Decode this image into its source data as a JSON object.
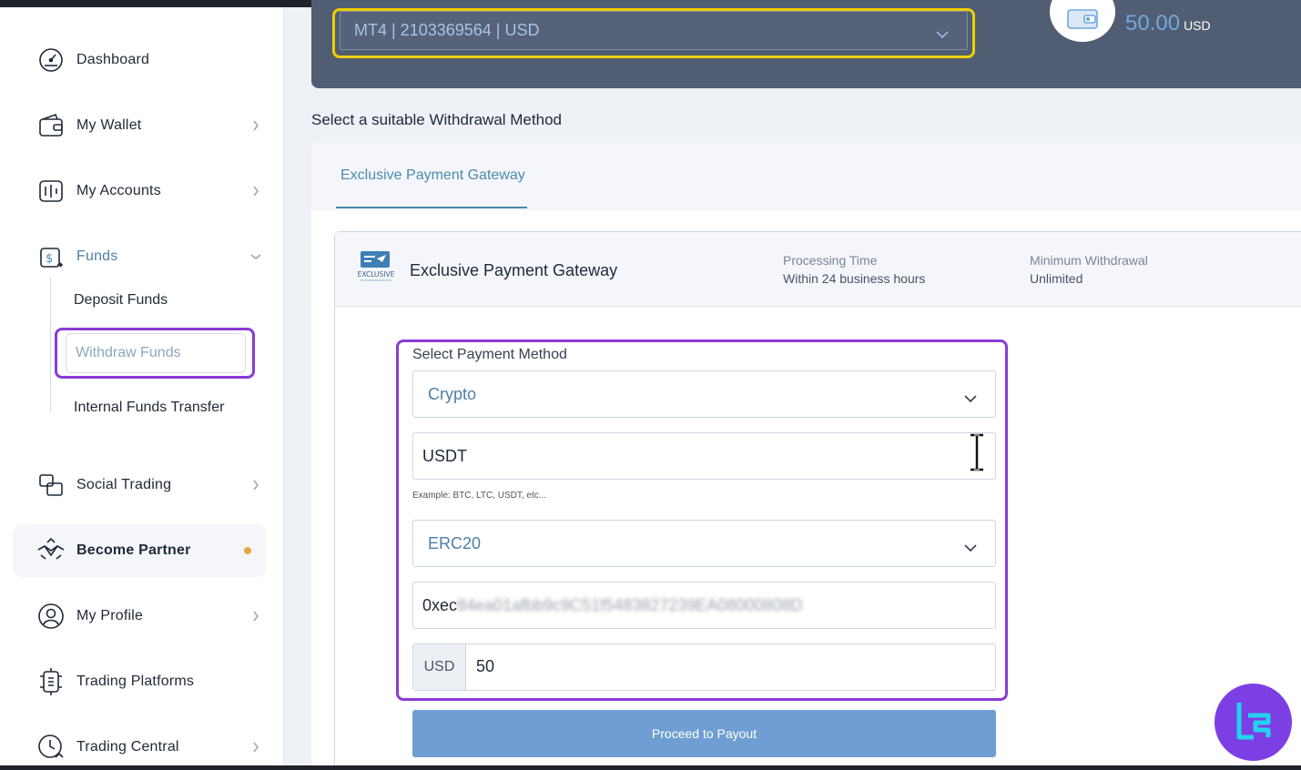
{
  "sidebar": {
    "items": [
      {
        "label": "Dashboard",
        "icon": "dashboard-gauge-icon"
      },
      {
        "label": "My Wallet",
        "icon": "wallet-icon"
      },
      {
        "label": "My Accounts",
        "icon": "accounts-icon"
      },
      {
        "label": "Funds",
        "icon": "funds-transfer-icon"
      },
      {
        "label": "Social Trading",
        "icon": "social-trading-icon"
      },
      {
        "label": "Become Partner",
        "icon": "handshake-icon"
      },
      {
        "label": "My Profile",
        "icon": "user-profile-icon"
      },
      {
        "label": "Trading Platforms",
        "icon": "platform-chip-icon"
      },
      {
        "label": "Trading Central",
        "icon": "clock-chart-icon"
      }
    ],
    "funds_sub": {
      "deposit": "Deposit Funds",
      "withdraw": "Withdraw Funds",
      "internal": "Internal Funds Transfer"
    }
  },
  "header": {
    "account_select": "MT4 | 2103369564 | USD",
    "balance_value": "50.00",
    "balance_currency": "USD"
  },
  "main": {
    "section_title": "Select a suitable Withdrawal Method",
    "tab": "Exclusive Payment Gateway",
    "gateway": {
      "name": "Exclusive Payment Gateway",
      "logo_text": "EXCLUSIVE",
      "processing_label": "Processing Time",
      "processing_value": "Within 24 business hours",
      "min_label": "Minimum Withdrawal",
      "min_value": "Unlimited"
    },
    "form": {
      "label": "Select Payment Method",
      "method": "Crypto",
      "currency": "USDT",
      "currency_hint": "Example: BTC, LTC, USDT, etc...",
      "network": "ERC20",
      "address_visible": "0xec",
      "address_blurred": "84ea01afbb9c9C51f5483827239EA08000808D",
      "amount_currency": "USD",
      "amount": "50",
      "submit": "Proceed to Payout"
    }
  },
  "colors": {
    "accent": "#4a8cab",
    "highlight_purple": "#8a3bd6",
    "highlight_yellow": "#f0cf00",
    "button": "#6f9ed2",
    "hero": "#515d72"
  }
}
